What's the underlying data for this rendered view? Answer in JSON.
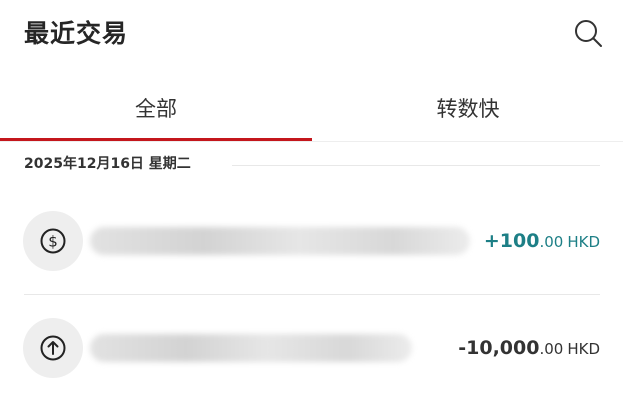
{
  "header": {
    "title": "最近交易",
    "search_icon": "search-icon"
  },
  "tabs": [
    {
      "label": "全部",
      "selected": true
    },
    {
      "label": "转数快",
      "selected": false
    }
  ],
  "accent_color": "#c4161c",
  "groups": [
    {
      "date_label": "2025年12月16日 星期二",
      "transactions": [
        {
          "icon": "dollar-icon",
          "description_obscured": true,
          "amount_int": "+100",
          "amount_dec": ".00",
          "currency": "HKD",
          "direction": "credit",
          "amount_color": "#1d7f86"
        },
        {
          "icon": "arrow-up-icon",
          "description_obscured": true,
          "amount_int": "-10,000",
          "amount_dec": ".00",
          "currency": "HKD",
          "direction": "debit",
          "amount_color": "#333333"
        }
      ]
    }
  ]
}
